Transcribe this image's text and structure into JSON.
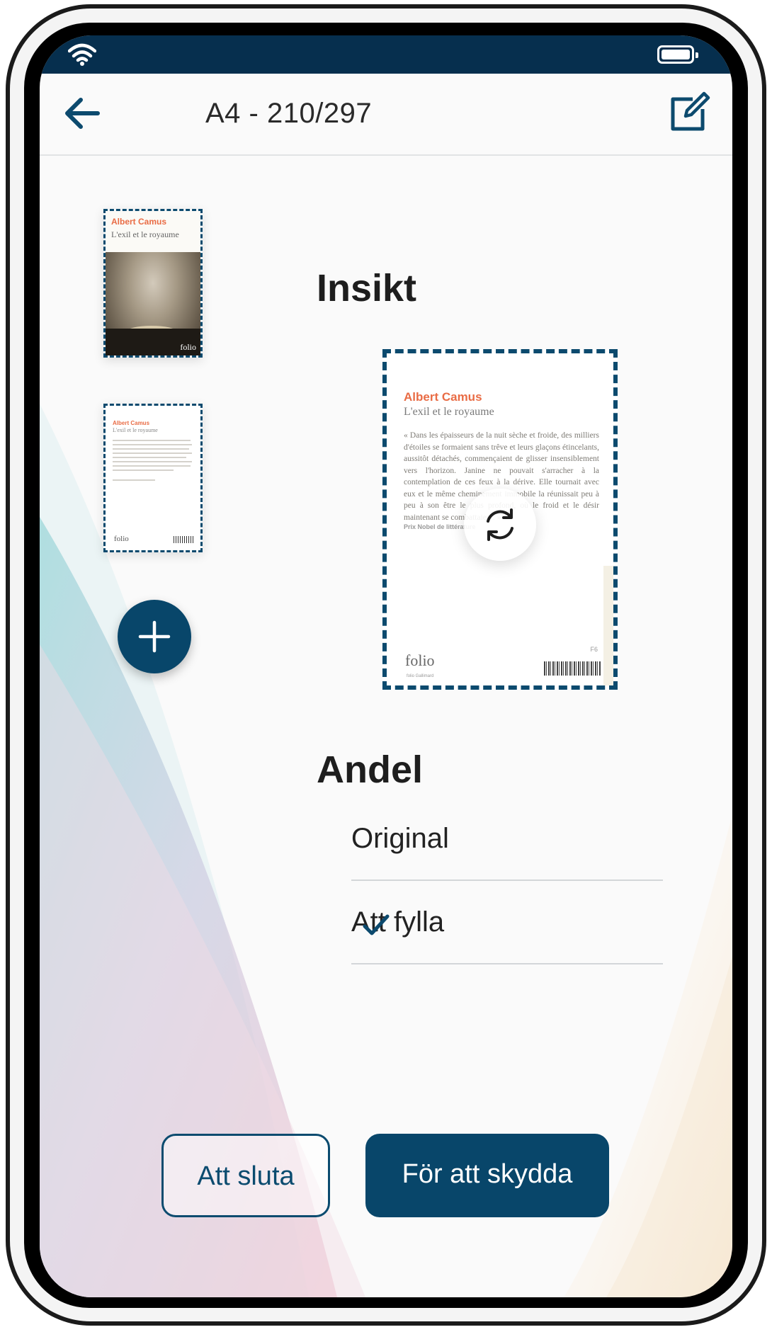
{
  "navbar": {
    "title": "A4 - 210/297"
  },
  "pages": [
    {
      "author": "Albert Camus",
      "title": "L'exil et le royaume",
      "logo": "folio"
    },
    {
      "author": "Albert Camus",
      "title": "L'exil et le royaume",
      "logo": "folio"
    }
  ],
  "preview": {
    "section_title": "Insikt",
    "author": "Albert Camus",
    "title": "L'exil et le royaume",
    "body": "« Dans les épaisseurs de la nuit sèche et froide, des milliers d'étoiles se formaient sans trêve et leurs glaçons étincelants, aussitôt détachés, commençaient de glisser insensiblement vers l'horizon. Janine ne pouvait s'arracher à la contemplation de ces feux à la dérive. Elle tournait avec eux et le même cheminement immobile la réunissait peu à peu à son être le plus profond, où le froid et le désir maintenant se combattaient. »",
    "prize": "Prix Nobel de littérature",
    "logo": "folio",
    "sub": "folio Gallimard",
    "price": "F6"
  },
  "proportion": {
    "section_title": "Andel",
    "options": [
      {
        "label": "Original",
        "selected": false
      },
      {
        "label": "Att fylla",
        "selected": true
      }
    ]
  },
  "buttons": {
    "secondary": "Att sluta",
    "primary": "För att skydda"
  },
  "colors": {
    "primary": "#08466a",
    "status_bar": "#062f4e",
    "accent_author": "#e96c45"
  },
  "icons": {
    "back": "arrow-left-icon",
    "edit": "edit-icon",
    "add": "plus-icon",
    "rotate": "rotate-icon",
    "check": "check-icon",
    "wifi": "wifi-icon",
    "battery": "battery-icon"
  }
}
